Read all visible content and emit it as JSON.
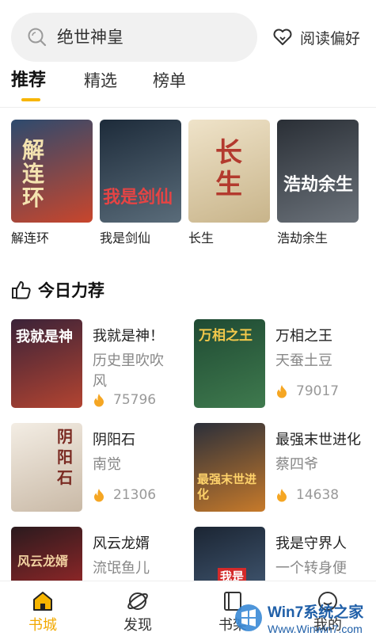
{
  "search": {
    "text": "绝世神皇"
  },
  "header": {
    "preference_label": "阅读偏好"
  },
  "tabs": [
    {
      "label": "推荐"
    },
    {
      "label": "精选"
    },
    {
      "label": "榜单"
    }
  ],
  "featured": [
    {
      "title": "解连环",
      "cover_text": "解连环",
      "colors": [
        "#2d4a6e",
        "#c9462c"
      ]
    },
    {
      "title": "我是剑仙",
      "cover_text": "我是剑仙",
      "colors": [
        "#1d2b3a",
        "#5a6c7a"
      ]
    },
    {
      "title": "长生",
      "cover_text": "长生",
      "colors": [
        "#efe3c9",
        "#c8b48a"
      ]
    },
    {
      "title": "浩劫余生",
      "cover_text": "浩劫余生",
      "colors": [
        "#2a2f36",
        "#6b727a"
      ]
    }
  ],
  "section": {
    "title": "今日力荐"
  },
  "recommendations": [
    {
      "name": "我就是神！",
      "author": "历史里吹吹风",
      "heat": "75796",
      "cover_text": "我就是神",
      "colors": [
        "#3a2238",
        "#b34431"
      ]
    },
    {
      "name": "万相之王",
      "author": "天蚕土豆",
      "heat": "79017",
      "cover_text": "万相之王",
      "colors": [
        "#1f4a33",
        "#3f7a4e"
      ]
    },
    {
      "name": "阴阳石",
      "author": "南觉",
      "heat": "21306",
      "cover_text": "阴阳石",
      "colors": [
        "#f3ede4",
        "#c9b9a6"
      ]
    },
    {
      "name": "最强末世进化",
      "author": "蔡四爷",
      "heat": "14638",
      "cover_text": "最强末世进化",
      "colors": [
        "#2b2f3a",
        "#c77a2a"
      ]
    },
    {
      "name": "风云龙婿",
      "author": "流氓鱼儿",
      "cover_text": "风云龙婿",
      "colors": [
        "#2a1a1e",
        "#b32b2b"
      ]
    },
    {
      "name": "我是守界人",
      "author": "一个转身便",
      "cover_text": "我是",
      "colors": [
        "#1b2533",
        "#4a6380"
      ]
    }
  ],
  "bottom_nav": [
    {
      "label": "书城",
      "icon": "home-icon"
    },
    {
      "label": "发现",
      "icon": "planet-icon"
    },
    {
      "label": "书架",
      "icon": "bookshelf-icon"
    },
    {
      "label": "我的",
      "icon": "profile-icon"
    }
  ],
  "watermark": {
    "text": "Win7系统之家",
    "url_text": "Www.Winwin7.com"
  },
  "colors": {
    "accent": "#f7b500",
    "nav_active": "#f2a900",
    "muted": "#888888"
  }
}
